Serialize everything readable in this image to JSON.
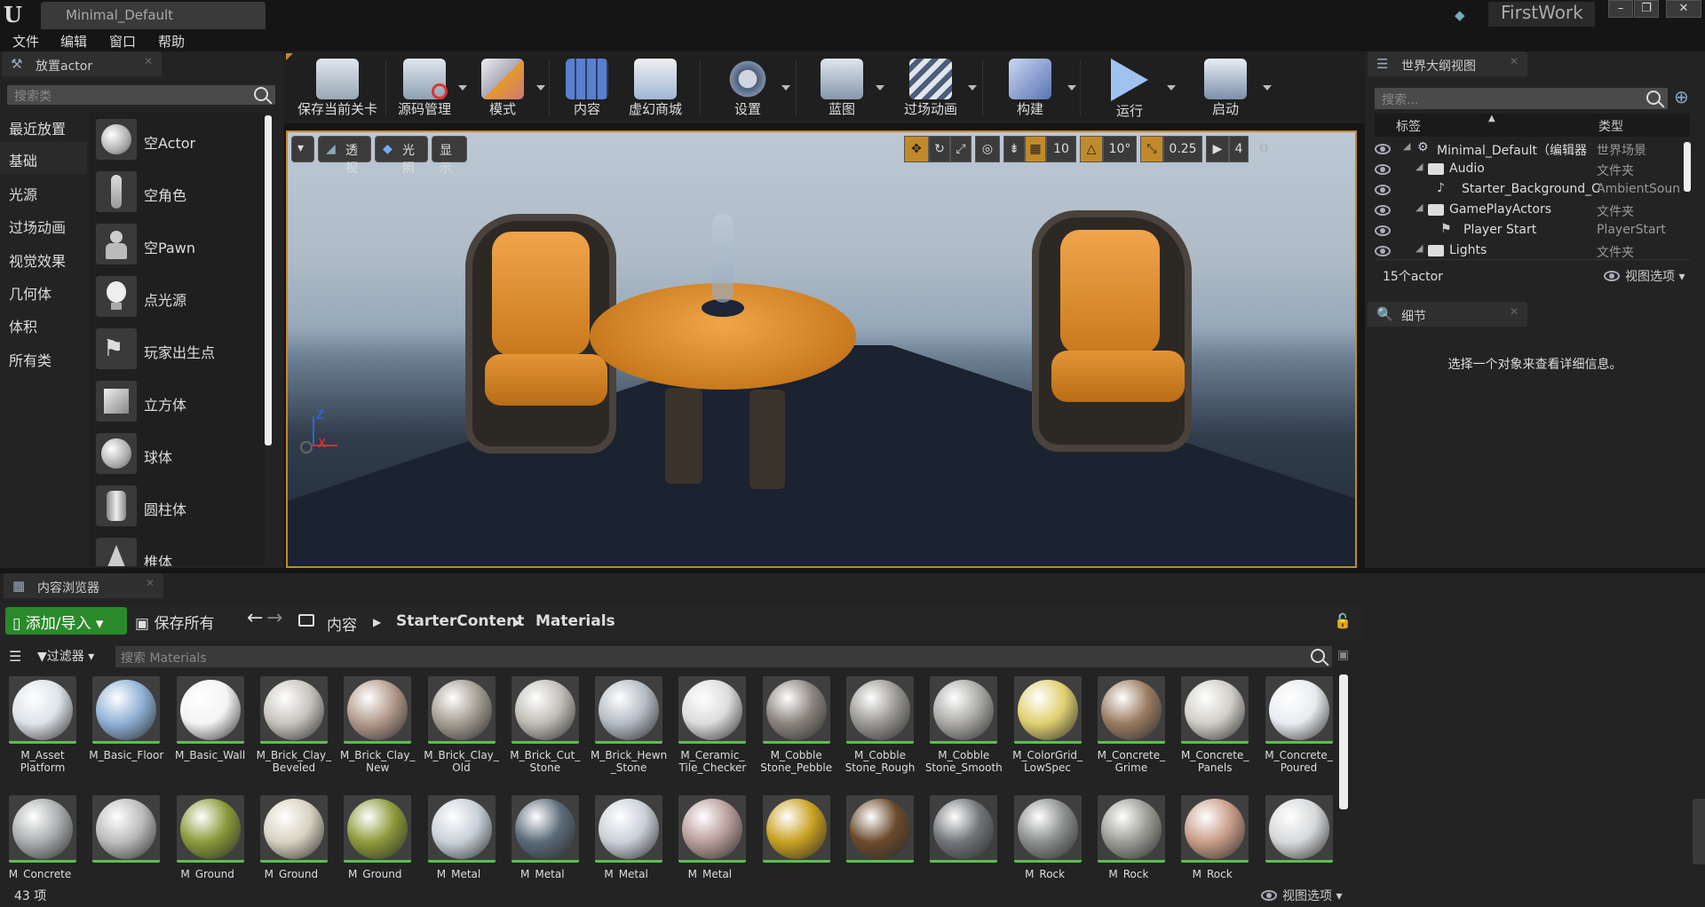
{
  "window": {
    "tab_title": "Minimal_Default",
    "project_name": "FirstWork",
    "controls": [
      "–",
      "❐",
      "✕"
    ]
  },
  "menu": [
    "文件",
    "编辑",
    "窗口",
    "帮助"
  ],
  "place_actor": {
    "tab_label": "放置actor",
    "search_placeholder": "搜索类",
    "categories": [
      "最近放置",
      "基础",
      "光源",
      "过场动画",
      "视觉效果",
      "几何体",
      "体积",
      "所有类"
    ],
    "active_category": "基础",
    "actors": [
      "空Actor",
      "空角色",
      "空Pawn",
      "点光源",
      "玩家出生点",
      "立方体",
      "球体",
      "圆柱体",
      "椎体"
    ]
  },
  "toolbar": {
    "buttons": [
      {
        "label": "保存当前关卡",
        "icon": "save-icon",
        "arrow": false
      },
      {
        "label": "源码管理",
        "icon": "source-control-icon",
        "arrow": true
      },
      {
        "label": "模式",
        "icon": "modes-icon",
        "arrow": true
      },
      {
        "label": "内容",
        "icon": "content-icon",
        "arrow": false
      },
      {
        "label": "虚幻商城",
        "icon": "marketplace-icon",
        "arrow": false
      },
      {
        "label": "设置",
        "icon": "settings-icon",
        "arrow": true
      },
      {
        "label": "蓝图",
        "icon": "blueprint-icon",
        "arrow": true
      },
      {
        "label": "过场动画",
        "icon": "cinematics-icon",
        "arrow": true
      },
      {
        "label": "构建",
        "icon": "build-icon",
        "arrow": true
      },
      {
        "label": "运行",
        "icon": "play-icon",
        "arrow": true
      },
      {
        "label": "启动",
        "icon": "launch-icon",
        "arrow": true
      }
    ]
  },
  "viewport": {
    "perspective_label": "透视",
    "lit_label": "光照",
    "show_label": "显示",
    "grid_snap": "10",
    "rotation_snap": "10°",
    "scale_snap": "0.25",
    "camera_speed": "4",
    "axis_z": "Z",
    "axis_x": "X"
  },
  "outliner": {
    "tab_label": "世界大纲视图",
    "search_placeholder": "搜索...",
    "col_label": "标签",
    "col_type": "类型",
    "rows": [
      {
        "name": "Minimal_Default（编辑器",
        "type": "世界场景"
      },
      {
        "name": "Audio",
        "type": "文件夹"
      },
      {
        "name": "Starter_Background_C",
        "type": "AmbientSoun"
      },
      {
        "name": "GamePlayActors",
        "type": "文件夹"
      },
      {
        "name": "Player Start",
        "type": "PlayerStart"
      },
      {
        "name": "Lights",
        "type": "文件夹"
      }
    ],
    "actor_count": "15个actor",
    "view_options": "视图选项"
  },
  "details": {
    "tab_label": "细节",
    "empty_message": "选择一个对象来查看详细信息。"
  },
  "content_browser": {
    "tab_label": "内容浏览器",
    "add_import": "添加/导入",
    "save_all": "保存所有",
    "path": [
      "内容",
      "StarterContent",
      "Materials"
    ],
    "filter_label": "过滤器",
    "search_placeholder": "搜索 Materials",
    "item_count": "43 项",
    "view_options": "视图选项",
    "assets_row1": [
      "M_Asset\nPlatform",
      "M_Basic_Floor",
      "M_Basic_Wall",
      "M_Brick_Clay_\nBeveled",
      "M_Brick_Clay_\nNew",
      "M_Brick_Clay_\nOld",
      "M_Brick_Cut_\nStone",
      "M_Brick_Hewn\n_Stone",
      "M_Ceramic_\nTile_Checker",
      "M_Cobble\nStone_Pebble",
      "M_Cobble\nStone_Rough",
      "M_Cobble\nStone_Smooth",
      "M_ColorGrid_\nLowSpec",
      "M_Concrete_\nGrime",
      "M_Concrete_\nPanels",
      "M_Concrete_\nPoured"
    ],
    "assets_row2": [
      "M_Concrete_",
      "",
      "M_Ground_",
      "M_Ground_",
      "M_Ground_",
      "M_Metal_",
      "M_Metal_",
      "M_Metal_",
      "M_Metal_",
      "",
      "",
      "",
      "M_Rock_",
      "M_Rock_",
      "M_Rock_",
      ""
    ]
  },
  "colors": {
    "accent_orange": "#c08a2a",
    "add_import_green": "#2a8a2a",
    "asset_underline": "#5bbf4d"
  }
}
